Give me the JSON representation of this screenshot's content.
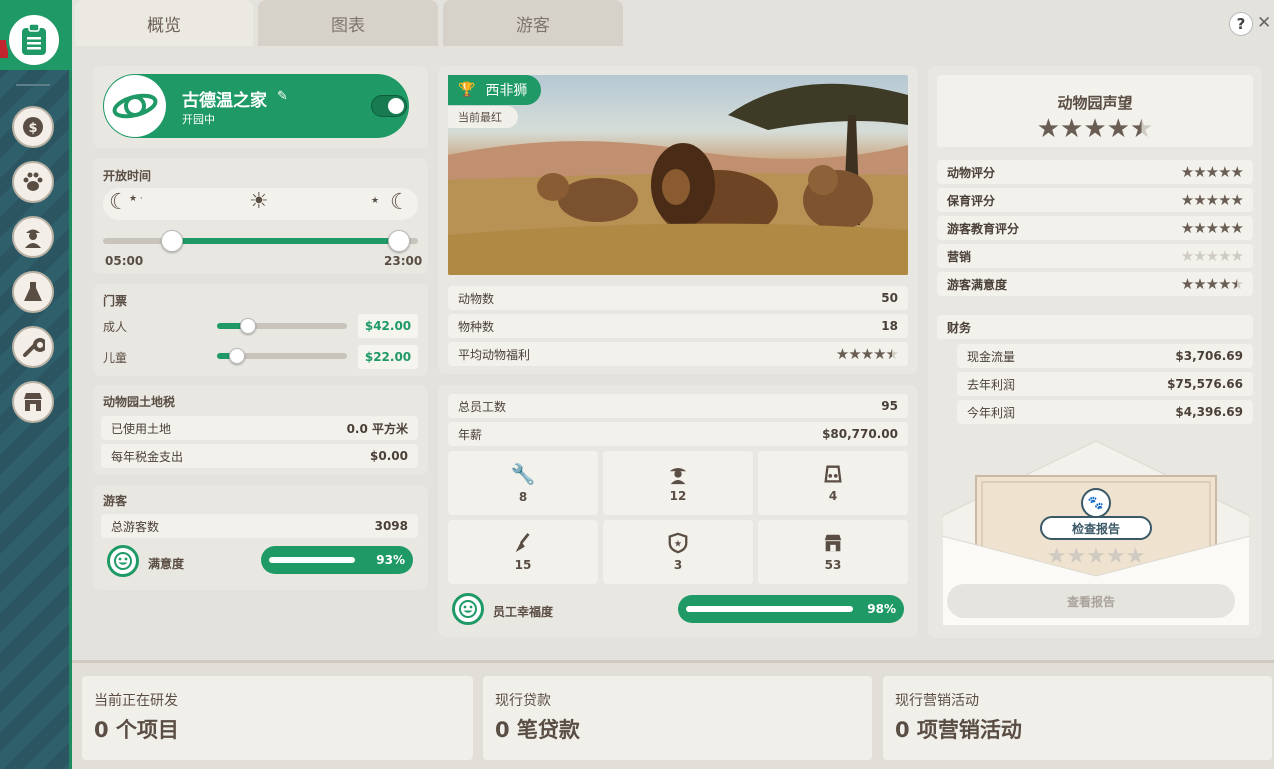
{
  "sidebar": {
    "icons": [
      "clipboard-icon",
      "money-icon",
      "paw-icon",
      "staff-icon",
      "research-icon",
      "tools-icon",
      "shop-icon"
    ]
  },
  "tabs": [
    {
      "label": "概览"
    },
    {
      "label": "图表"
    },
    {
      "label": "游客"
    }
  ],
  "window": {
    "help": "?",
    "close": "✕"
  },
  "zoo": {
    "name": "古德温之家",
    "status": "开园中",
    "open": true
  },
  "hours": {
    "title": "开放时间",
    "open_time": "05:00",
    "close_time": "23:00",
    "open_frac": 0.22,
    "close_frac": 0.94
  },
  "tickets": {
    "title": "门票",
    "adult_label": "成人",
    "adult_price": "$42.00",
    "adult_frac": 0.24,
    "child_label": "儿童",
    "child_price": "$22.00",
    "child_frac": 0.15
  },
  "land": {
    "title": "动物园土地税",
    "used_label": "已使用土地",
    "used_value": "0.0 平方米",
    "tax_label": "每年税金支出",
    "tax_value": "$0.00"
  },
  "guests": {
    "title": "游客",
    "total_label": "总游客数",
    "total_value": "3098",
    "satisfaction_label": "满意度",
    "satisfaction_value": "93%",
    "satisfaction_frac": 0.93
  },
  "featured": {
    "name": "西非狮",
    "caption": "当前最红"
  },
  "animals": {
    "count_label": "动物数",
    "count_value": "50",
    "species_label": "物种数",
    "species_value": "18",
    "welfare_label": "平均动物福利",
    "welfare_rating": 4.5
  },
  "staff": {
    "total_label": "总员工数",
    "total_value": "95",
    "salary_label": "年薪",
    "salary_value": "$80,770.00",
    "roles": [
      {
        "icon": "wrench-icon",
        "count": "8"
      },
      {
        "icon": "keeper-icon",
        "count": "12"
      },
      {
        "icon": "vendor-icon",
        "count": "4"
      },
      {
        "icon": "broom-icon",
        "count": "15"
      },
      {
        "icon": "security-icon",
        "count": "3"
      },
      {
        "icon": "shop-icon",
        "count": "53"
      }
    ],
    "happiness_label": "员工幸福度",
    "happiness_value": "98%",
    "happiness_frac": 0.98
  },
  "reputation": {
    "title": "动物园声望",
    "rating": 4.5,
    "items": [
      {
        "label": "动物评分",
        "rating": 5
      },
      {
        "label": "保育评分",
        "rating": 5
      },
      {
        "label": "游客教育评分",
        "rating": 5
      },
      {
        "label": "营销",
        "rating": 0
      },
      {
        "label": "游客满意度",
        "rating": 4.5
      }
    ]
  },
  "finance": {
    "title": "财务",
    "items": [
      {
        "label": "现金流量",
        "value": "$3,706.69"
      },
      {
        "label": "去年利润",
        "value": "$75,576.66"
      },
      {
        "label": "今年利润",
        "value": "$4,396.69"
      }
    ]
  },
  "report": {
    "check_label": "检查报告",
    "view_label": "查看报告"
  },
  "bottom": {
    "research_label": "当前正在研发",
    "research_value": "0 个项目",
    "loans_label": "现行贷款",
    "loans_value": "0 笔贷款",
    "marketing_label": "现行营销活动",
    "marketing_value": "0 项营销活动"
  }
}
